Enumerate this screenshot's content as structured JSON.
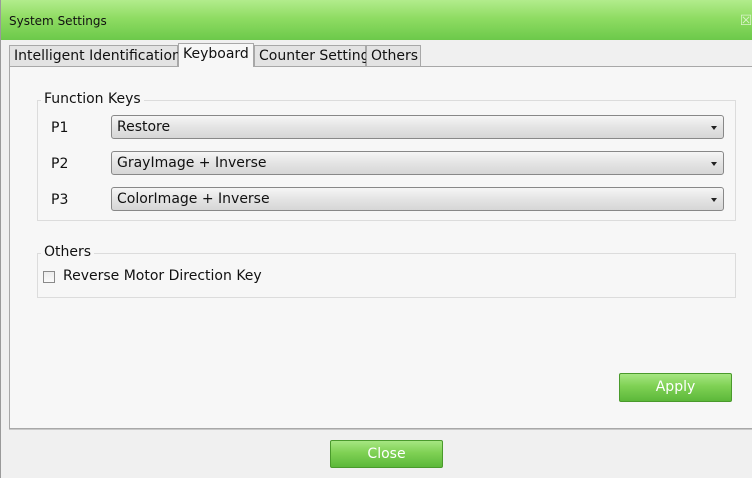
{
  "window": {
    "title": "System Settings",
    "close_glyph": "☒",
    "accent_color": "#6cc94a"
  },
  "tabs": [
    {
      "label": "Intelligent Identification",
      "active": false
    },
    {
      "label": "Keyboard",
      "active": true
    },
    {
      "label": "Counter Setting",
      "active": false
    },
    {
      "label": "Others",
      "active": false
    }
  ],
  "function_keys": {
    "title": "Function Keys",
    "rows": [
      {
        "label": "P1",
        "value": "Restore"
      },
      {
        "label": "P2",
        "value": "GrayImage + Inverse"
      },
      {
        "label": "P3",
        "value": "ColorImage + Inverse"
      }
    ]
  },
  "others_group": {
    "title": "Others",
    "checkbox_label": "Reverse Motor Direction Key",
    "checked": false
  },
  "buttons": {
    "apply": "Apply",
    "close": "Close"
  }
}
